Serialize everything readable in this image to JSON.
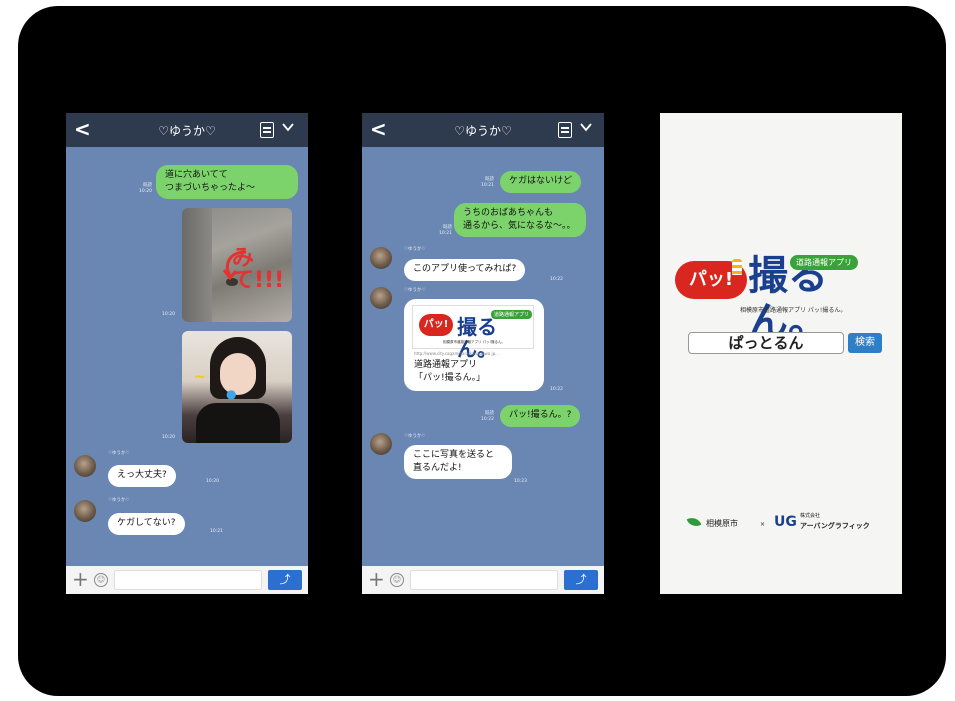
{
  "colors": {
    "frame": "#000000",
    "chat_bg": "#6a87b3",
    "header_bg": "#2e3a4e",
    "green_bubble": "#7dd36b",
    "send_button": "#2b6fd1",
    "brand_red": "#d9271f",
    "brand_blue": "#1b3f8f",
    "brand_green": "#3aa23a"
  },
  "chat1": {
    "header": {
      "back": "<",
      "title": "♡ゆうか♡"
    },
    "messages": [
      {
        "from": "me",
        "read": "既読\n10:20",
        "text": "道に穴あいてて\nつまづいちゃったよ〜"
      },
      {
        "from": "me",
        "type": "photo",
        "caption": "road-pothole",
        "scribble": "みて!!!",
        "time": "10:20"
      },
      {
        "from": "me",
        "type": "photo",
        "caption": "selfie",
        "time": "10:20"
      },
      {
        "from": "them",
        "name": "♡ゆうか♡",
        "text": "えっ大丈夫?",
        "time": "10:20"
      },
      {
        "from": "them",
        "name": "♡ゆうか♡",
        "text": "ケガしてない?",
        "time": "10:21"
      }
    ]
  },
  "chat2": {
    "header": {
      "back": "<",
      "title": "♡ゆうか♡"
    },
    "messages": [
      {
        "from": "me",
        "read": "既読\n10:21",
        "text": "ケガはないけど"
      },
      {
        "from": "me",
        "read": "既読\n10:21",
        "text": "うちのおばあちゃんも\n通るから、気になるな〜。。"
      },
      {
        "from": "them",
        "name": "♡ゆうか♡",
        "text": "このアプリ使ってみれば?",
        "time": "10:22"
      },
      {
        "from": "them",
        "name": "♡ゆうか♡",
        "type": "card",
        "logo_text": "パッ!",
        "logo_kanji": "撮るん。",
        "logo_tag": "道路通報アプリ",
        "logo_sub": "相模原市道路通報アプリ パッ!撮るん。",
        "url": "http://www.city.sagamihara.kanagawa.jp...",
        "text": "道路通報アプリ\n「パッ!撮るん。」",
        "time": "10:22"
      },
      {
        "from": "me",
        "read": "既読\n10:22",
        "text": "パッ!撮るん。?"
      },
      {
        "from": "them",
        "name": "♡ゆうか♡",
        "text": "ここに写真を送ると\n直るんだよ!",
        "time": "10:23"
      }
    ]
  },
  "splash": {
    "logo_text": "パッ!",
    "logo_kanji": "撮るん。",
    "logo_tag": "道路通報アプリ",
    "logo_sub": "相模原市道路通報アプリ パッ!撮るん。",
    "search_text": "ぱっとるん",
    "search_button": "検索",
    "city_logo": "相模原市",
    "cross": "×",
    "company_prefix": "株式会社",
    "company_name": "アーバングラフィック"
  }
}
